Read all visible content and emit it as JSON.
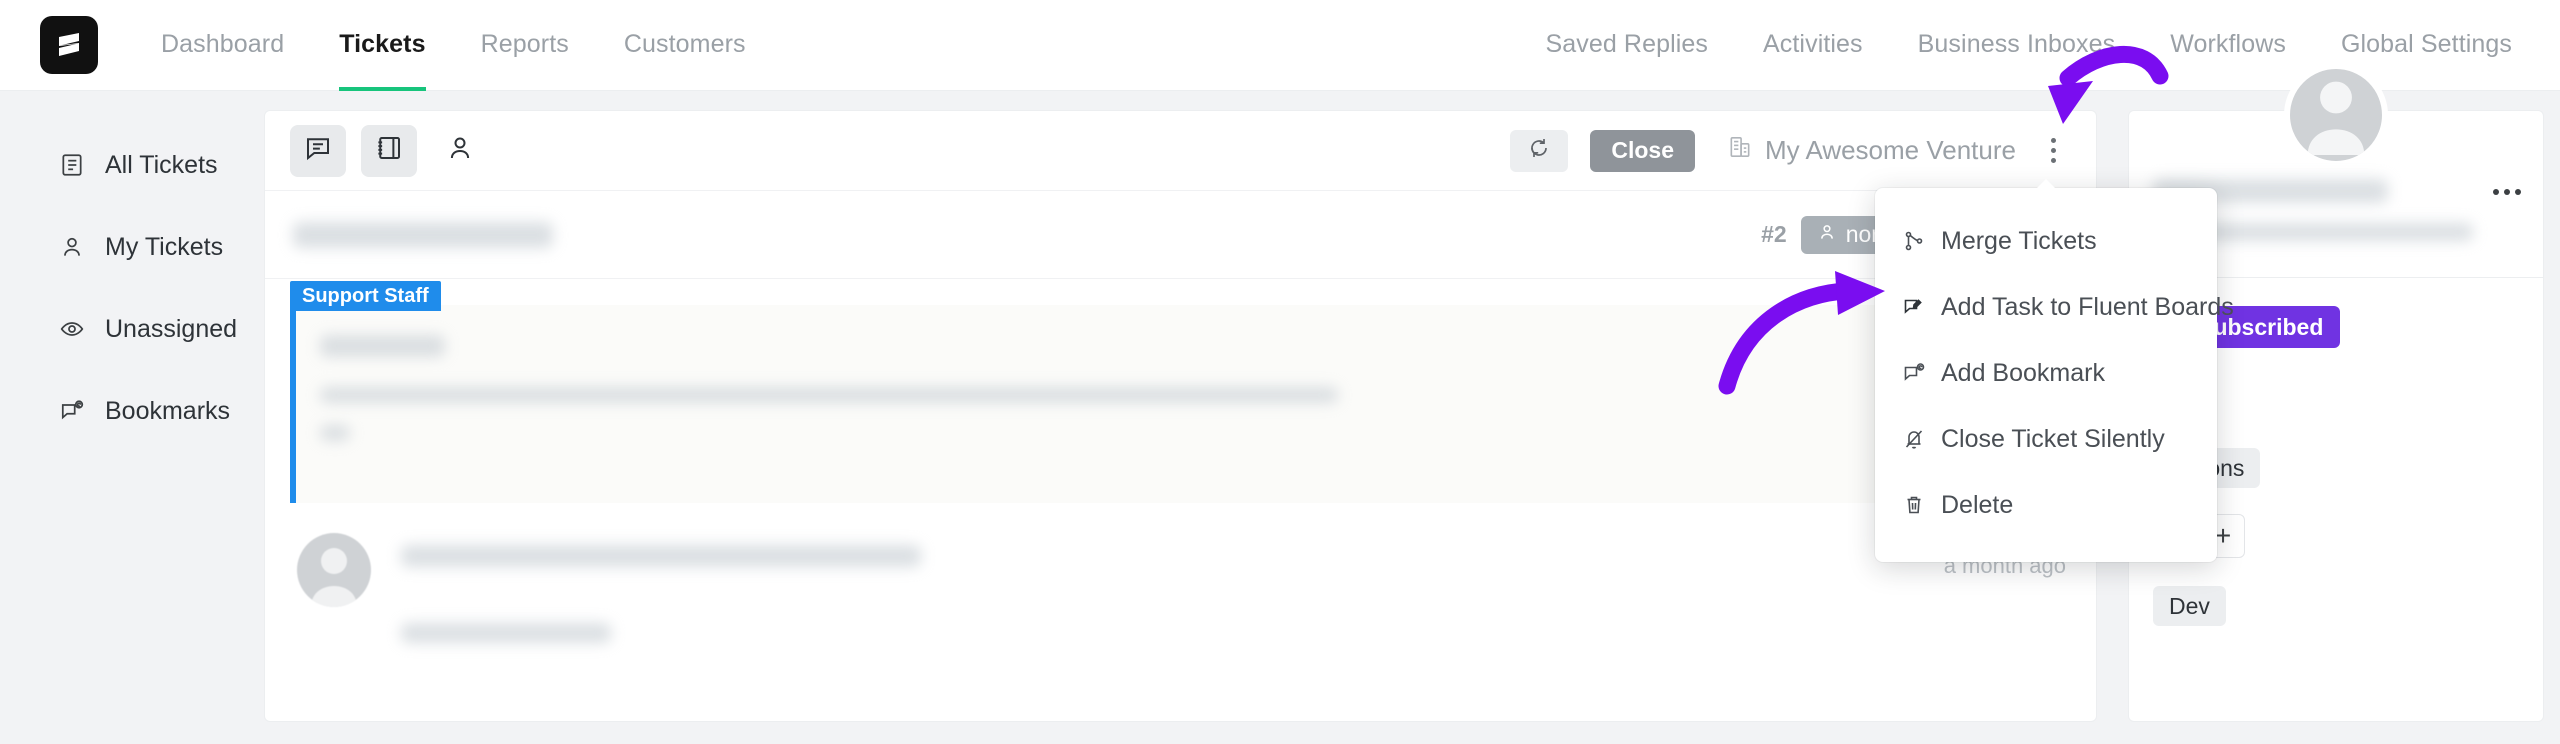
{
  "brand": {
    "logo_icon": "fluent-support-logo",
    "accent_green": "#17c47c",
    "accent_purple": "#7033e2",
    "annotation_purple": "#7a0df0",
    "staff_blue": "#1f8ceb"
  },
  "topnav": {
    "left_items": [
      {
        "label": "Dashboard",
        "active": false,
        "name": "nav-dashboard"
      },
      {
        "label": "Tickets",
        "active": true,
        "name": "nav-tickets"
      },
      {
        "label": "Reports",
        "active": false,
        "name": "nav-reports"
      },
      {
        "label": "Customers",
        "active": false,
        "name": "nav-customers"
      }
    ],
    "right_items": [
      {
        "label": "Saved Replies",
        "name": "nav-saved-replies"
      },
      {
        "label": "Activities",
        "name": "nav-activities"
      },
      {
        "label": "Business Inboxes",
        "name": "nav-business-inboxes"
      },
      {
        "label": "Workflows",
        "name": "nav-workflows"
      },
      {
        "label": "Global Settings",
        "name": "nav-global-settings"
      }
    ]
  },
  "sidebar": {
    "items": [
      {
        "label": "All Tickets",
        "icon": "list-document-icon"
      },
      {
        "label": "My Tickets",
        "icon": "person-icon"
      },
      {
        "label": "Unassigned",
        "icon": "eye-icon"
      },
      {
        "label": "Bookmarks",
        "icon": "bookmark-chat-icon"
      }
    ]
  },
  "toolbar": {
    "view_buttons": [
      {
        "icon": "chat-bubble-icon",
        "active": true
      },
      {
        "icon": "notebook-icon",
        "active": true
      },
      {
        "icon": "person-outline-icon",
        "active": false
      }
    ],
    "refresh_icon": "refresh-icon",
    "close_label": "Close",
    "business_icon": "building-icon",
    "business_name": "My Awesome Venture",
    "kebab_icon": "more-vertical-icon"
  },
  "ticket": {
    "id_label": "#2",
    "priority_badge": {
      "label": "normal",
      "icon": "person-icon"
    },
    "staff_badge": "Support Staff",
    "comment_time": "a month ago"
  },
  "menu": {
    "items": [
      {
        "label": "Merge Tickets",
        "icon": "merge-icon"
      },
      {
        "label": "Add Task to Fluent Boards",
        "icon": "task-edit-icon"
      },
      {
        "label": "Add Bookmark",
        "icon": "bookmark-chat-icon"
      },
      {
        "label": "Close Ticket Silently",
        "icon": "bell-off-icon"
      },
      {
        "label": "Delete",
        "icon": "trash-icon"
      }
    ]
  },
  "right_panel": {
    "subscribe_label": "Unsubscribed",
    "actions_label": "Actions",
    "add_label": "+",
    "tag_label": "Dev",
    "list_icon": "list-icon",
    "more_icon": "more-horizontal-icon"
  },
  "annotations": [
    {
      "name": "arrow-to-kebab-menu",
      "color": "#7a0df0"
    },
    {
      "name": "arrow-to-add-task-item",
      "color": "#7a0df0"
    }
  ]
}
